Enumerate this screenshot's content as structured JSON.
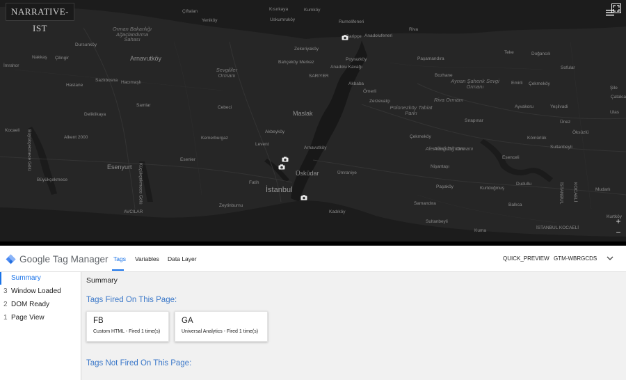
{
  "map": {
    "logo_text": "NARRATIVE-IST",
    "zoom_in": "+",
    "zoom_out": "−",
    "labels": [
      {
        "text": "Kısırkaya",
        "cls": ""
      },
      {
        "text": "Kumköy",
        "cls": ""
      },
      {
        "text": "Uskumruköy",
        "cls": ""
      },
      {
        "text": "Rumelifeneri",
        "cls": ""
      },
      {
        "text": "Riva",
        "cls": ""
      },
      {
        "text": "Garipçe",
        "cls": ""
      },
      {
        "text": "Anadolufeneri",
        "cls": ""
      },
      {
        "text": "Zekeriyaköy",
        "cls": ""
      },
      {
        "text": "Orman Bakanlığı Ağaçlandırma Sahası",
        "cls": "park"
      },
      {
        "text": "Çiftalan",
        "cls": ""
      },
      {
        "text": "Yeniköy",
        "cls": ""
      },
      {
        "text": "Dursunköy",
        "cls": ""
      },
      {
        "text": "Nakkaş",
        "cls": ""
      },
      {
        "text": "Çilingir",
        "cls": ""
      },
      {
        "text": "Arnavutköy",
        "cls": "medium"
      },
      {
        "text": "İmrahor",
        "cls": ""
      },
      {
        "text": "Bahçeköy Merkez",
        "cls": ""
      },
      {
        "text": "Sevgililer Ormanı",
        "cls": "park"
      },
      {
        "text": "SARIYER",
        "cls": ""
      },
      {
        "text": "Poyrazköy",
        "cls": ""
      },
      {
        "text": "Paşamandıra",
        "cls": ""
      },
      {
        "text": "Teke",
        "cls": ""
      },
      {
        "text": "Doğancılı",
        "cls": ""
      },
      {
        "text": "Sofular",
        "cls": ""
      },
      {
        "text": "Bozhane",
        "cls": ""
      },
      {
        "text": "Anadolu Kavağı",
        "cls": ""
      },
      {
        "text": "Hastane",
        "cls": ""
      },
      {
        "text": "Sazlıbosna",
        "cls": ""
      },
      {
        "text": "Hacımaşlı",
        "cls": ""
      },
      {
        "text": "Akbaba",
        "cls": ""
      },
      {
        "text": "Aynan Şahenk Sevgi Ormanı",
        "cls": "park"
      },
      {
        "text": "Ömerli",
        "cls": ""
      },
      {
        "text": "Alemdağ Ormanı",
        "cls": "park"
      },
      {
        "text": "Emirli",
        "cls": ""
      },
      {
        "text": "Riva Ormanı",
        "cls": "park"
      },
      {
        "text": "Çekmeköy",
        "cls": ""
      },
      {
        "text": "Şile",
        "cls": ""
      },
      {
        "text": "Çatalca",
        "cls": ""
      },
      {
        "text": "Samlar",
        "cls": ""
      },
      {
        "text": "Cebeci",
        "cls": ""
      },
      {
        "text": "Maslak",
        "cls": "medium"
      },
      {
        "text": "Zerzevatçı",
        "cls": ""
      },
      {
        "text": "Polonezköy Tabiat Parkı",
        "cls": "park"
      },
      {
        "text": "Ayvakoru",
        "cls": ""
      },
      {
        "text": "Yeşilvadi",
        "cls": ""
      },
      {
        "text": "Ulas",
        "cls": ""
      },
      {
        "text": "Deliklikaya",
        "cls": ""
      },
      {
        "text": "Sırapınar",
        "cls": ""
      },
      {
        "text": "Ünez",
        "cls": ""
      },
      {
        "text": "Öksüzlü",
        "cls": ""
      },
      {
        "text": "Akbeyköy",
        "cls": ""
      },
      {
        "text": "Kocaeli",
        "cls": ""
      },
      {
        "text": "Alkent 2000",
        "cls": ""
      },
      {
        "text": "Büyükçekmece Gölü",
        "cls": "vert"
      },
      {
        "text": "Kemerburgaz",
        "cls": ""
      },
      {
        "text": "Levent",
        "cls": ""
      },
      {
        "text": "Arnavutköy",
        "cls": ""
      },
      {
        "text": "Çekmeköy",
        "cls": ""
      },
      {
        "text": "Alemdağ Ormanı",
        "cls": "park"
      },
      {
        "text": "Kömürlük",
        "cls": ""
      },
      {
        "text": "Sultanbeyli",
        "cls": ""
      },
      {
        "text": "Nişantaşı",
        "cls": ""
      },
      {
        "text": "Esenyurt",
        "cls": "medium"
      },
      {
        "text": "Küçükçekmece Gölü",
        "cls": "vert"
      },
      {
        "text": "Esenler",
        "cls": ""
      },
      {
        "text": "Üsküdar",
        "cls": "medium"
      },
      {
        "text": "Ümraniye",
        "cls": ""
      },
      {
        "text": "Esenceli",
        "cls": ""
      },
      {
        "text": "Büyükçekmece",
        "cls": ""
      },
      {
        "text": "Fatih",
        "cls": ""
      },
      {
        "text": "İstanbul",
        "cls": "large"
      },
      {
        "text": "Paşaköy",
        "cls": ""
      },
      {
        "text": "Kurtdoğmuş",
        "cls": ""
      },
      {
        "text": "Dudullu",
        "cls": ""
      },
      {
        "text": "Mudarlı",
        "cls": ""
      },
      {
        "text": "AVCILAR",
        "cls": ""
      },
      {
        "text": "Zeytinburnu",
        "cls": ""
      },
      {
        "text": "Kadıköy",
        "cls": ""
      },
      {
        "text": "Samandıra",
        "cls": ""
      },
      {
        "text": "Ballıca",
        "cls": ""
      },
      {
        "text": "İSTANBUL",
        "cls": "vert"
      },
      {
        "text": "KOCAELİ",
        "cls": "vert"
      },
      {
        "text": "Sultanbeyli",
        "cls": ""
      },
      {
        "text": "Kuma",
        "cls": ""
      },
      {
        "text": "İSTANBUL KOCAELİ",
        "cls": ""
      },
      {
        "text": "Kurtköy",
        "cls": ""
      }
    ]
  },
  "gtm": {
    "product_google": "Google",
    "product_name": "Tag Manager",
    "tabs": [
      "Tags",
      "Variables",
      "Data Layer"
    ],
    "quick_preview": "QUICK_PREVIEW",
    "container_id": "GTM-WBRGCDS",
    "colors": {
      "accent": "#1a73e8",
      "section": "#3b78c9"
    }
  },
  "sidebar": {
    "items": [
      {
        "num": "",
        "label": "Summary"
      },
      {
        "num": "3",
        "label": "Window Loaded"
      },
      {
        "num": "2",
        "label": "DOM Ready"
      },
      {
        "num": "1",
        "label": "Page View"
      }
    ]
  },
  "main": {
    "title": "Summary",
    "fired_title": "Tags Fired On This Page:",
    "not_fired_title": "Tags Not Fired On This Page:",
    "fired_tags": [
      {
        "name": "FB",
        "desc": "Custom HTML - Fired 1 time(s)"
      },
      {
        "name": "GA",
        "desc": "Universal Analytics - Fired 1 time(s)"
      }
    ]
  }
}
